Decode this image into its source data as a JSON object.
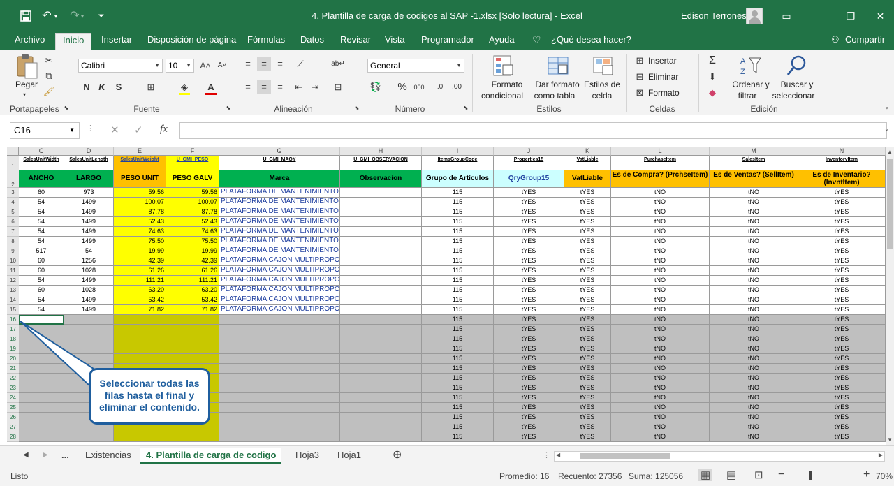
{
  "window": {
    "title": "4. Plantilla de carga de codigos al SAP -1.xlsx  [Solo lectura]  -  Excel",
    "user": "Edison Terrones"
  },
  "icons": {
    "save": "save-icon",
    "undo": "undo-icon",
    "redo": "redo-icon",
    "customize": "customize-qat-icon",
    "share": "user-share-icon",
    "lightbulb": "lightbulb-icon"
  },
  "tabs": [
    "Archivo",
    "Inicio",
    "Insertar",
    "Disposición de página",
    "Fórmulas",
    "Datos",
    "Revisar",
    "Vista",
    "Programador",
    "Ayuda"
  ],
  "tell_me": "¿Qué desea hacer?",
  "share": "Compartir",
  "ribbon": {
    "clipboard": {
      "label": "Portapapeles",
      "paste": "Pegar"
    },
    "font": {
      "label": "Fuente",
      "name": "Calibri",
      "size": "10",
      "bold": "N",
      "italic": "K",
      "underline": "S"
    },
    "alignment": {
      "label": "Alineación"
    },
    "number": {
      "label": "Número",
      "format": "General",
      "percent": "%",
      "thousands": "000"
    },
    "styles": {
      "label": "Estilos",
      "cond_format": [
        "Formato",
        "condicional"
      ],
      "as_table": [
        "Dar formato",
        "como tabla"
      ],
      "cell_styles": [
        "Estilos de",
        "celda"
      ]
    },
    "cells": {
      "label": "Celdas",
      "insert": "Insertar",
      "delete": "Eliminar",
      "format": "Formato"
    },
    "editing": {
      "label": "Edición",
      "sort": [
        "Ordenar y",
        "filtrar"
      ],
      "find": [
        "Buscar y",
        "seleccionar"
      ]
    }
  },
  "formula_bar": {
    "name_box": "C16",
    "value": ""
  },
  "columns": [
    "C",
    "D",
    "E",
    "F",
    "G",
    "H",
    "I",
    "J",
    "K",
    "L",
    "M",
    "N"
  ],
  "header1": [
    "SalesUnitWidth",
    "SalesUnitLength",
    "SalesUnitWeight",
    "U_GMI_PESO",
    "U_GMI_MAQY",
    "U_GMI_OBSERVACION",
    "ItemsGroupCode",
    "Properties15",
    "VatLiable",
    "PurchaseItem",
    "SalesItem",
    "InventoryItem"
  ],
  "header2": [
    "ANCHO",
    "LARGO",
    "PESO UNIT",
    "PESO GALV",
    "Marca",
    "Observacion",
    "Grupo de Artículos",
    "QryGroup15",
    "VatLiable",
    "Es de Compra? (PrchseItem)",
    "Es de Ventas? (SellItem)",
    "Es de Inventario? (InvntItem)"
  ],
  "rows": [
    {
      "n": "3",
      "w": "60",
      "l": "973",
      "pu": "59.56",
      "pg": "59.56",
      "m": "PLATAFORMA DE MANTENIMIENTO"
    },
    {
      "n": "4",
      "w": "54",
      "l": "1499",
      "pu": "100.07",
      "pg": "100.07",
      "m": "PLATAFORMA DE MANTENIMIENTO"
    },
    {
      "n": "5",
      "w": "54",
      "l": "1499",
      "pu": "87.78",
      "pg": "87.78",
      "m": "PLATAFORMA DE MANTENIMIENTO"
    },
    {
      "n": "6",
      "w": "54",
      "l": "1499",
      "pu": "52.43",
      "pg": "52.43",
      "m": "PLATAFORMA DE MANTENIMIENTO"
    },
    {
      "n": "7",
      "w": "54",
      "l": "1499",
      "pu": "74.63",
      "pg": "74.63",
      "m": "PLATAFORMA DE MANTENIMIENTO"
    },
    {
      "n": "8",
      "w": "54",
      "l": "1499",
      "pu": "75.50",
      "pg": "75.50",
      "m": "PLATAFORMA DE MANTENIMIENTO"
    },
    {
      "n": "9",
      "w": "517",
      "l": "54",
      "pu": "19.99",
      "pg": "19.99",
      "m": "PLATAFORMA DE MANTENIMIENTO"
    },
    {
      "n": "10",
      "w": "60",
      "l": "1256",
      "pu": "42.39",
      "pg": "42.39",
      "m": "PLATAFORMA CAJON MULTIPROPOSITO"
    },
    {
      "n": "11",
      "w": "60",
      "l": "1028",
      "pu": "61.26",
      "pg": "61.26",
      "m": "PLATAFORMA CAJON MULTIPROPOSITO"
    },
    {
      "n": "12",
      "w": "54",
      "l": "1499",
      "pu": "111.21",
      "pg": "111.21",
      "m": "PLATAFORMA CAJON MULTIPROPOSITO"
    },
    {
      "n": "13",
      "w": "60",
      "l": "1028",
      "pu": "63.20",
      "pg": "63.20",
      "m": "PLATAFORMA CAJON MULTIPROPOSITO"
    },
    {
      "n": "14",
      "w": "54",
      "l": "1499",
      "pu": "53.42",
      "pg": "53.42",
      "m": "PLATAFORMA CAJON MULTIPROPOSITO"
    },
    {
      "n": "15",
      "w": "54",
      "l": "1499",
      "pu": "71.82",
      "pg": "71.82",
      "m": "PLATAFORMA CAJON MULTIPROPOSITO"
    }
  ],
  "empty_rows": [
    "16",
    "17",
    "18",
    "19",
    "20",
    "21",
    "22",
    "23",
    "24",
    "25",
    "26",
    "27",
    "28"
  ],
  "const_vals": {
    "group": "115",
    "prop": "tYES",
    "vat": "tYES",
    "purchase": "tNO",
    "sales": "tNO",
    "inventory": "tYES"
  },
  "callout": "Seleccionar todas las filas hasta el final y eliminar el contenido.",
  "sheet_tabs": {
    "more": "...",
    "tabs": [
      "Existencias",
      "4. Plantilla de carga de codigo",
      "Hoja3",
      "Hoja1"
    ],
    "active_index": 1
  },
  "status": {
    "ready": "Listo",
    "average": "Promedio: 16",
    "count": "Recuento: 27356",
    "sum": "Suma: 125056",
    "zoom": "70%"
  },
  "colors": {
    "accent": "#217346",
    "yellow": "#ffff00",
    "orange": "#ffc000",
    "green": "#00b050",
    "cyan": "#ccffff",
    "gray": "#bfbfbf",
    "olive": "#c8c800"
  }
}
